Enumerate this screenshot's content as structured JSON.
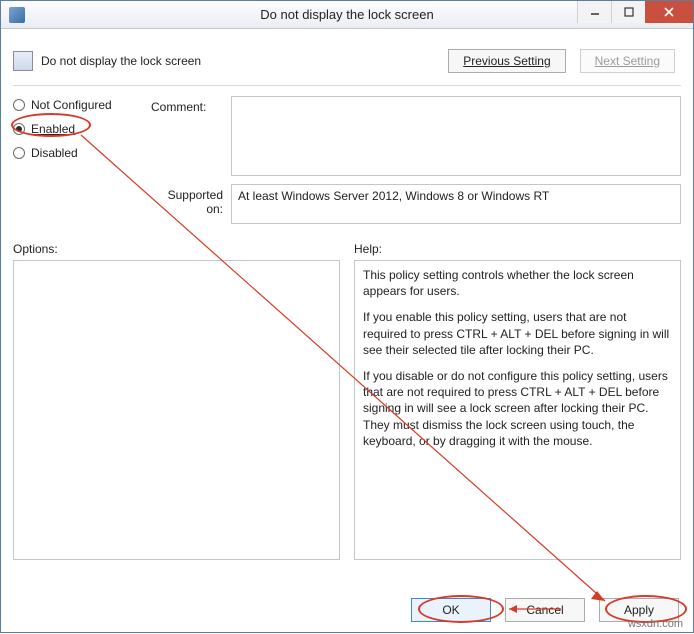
{
  "window": {
    "title": "Do not display the lock screen"
  },
  "header": {
    "policy_name": "Do not display the lock screen"
  },
  "nav": {
    "previous": "Previous Setting",
    "next": "Next Setting"
  },
  "state": {
    "not_configured": "Not Configured",
    "enabled": "Enabled",
    "disabled": "Disabled",
    "selected": "enabled"
  },
  "labels": {
    "comment": "Comment:",
    "supported_on": "Supported on:",
    "options": "Options:",
    "help": "Help:"
  },
  "fields": {
    "comment": "",
    "supported_on": "At least Windows Server 2012, Windows 8 or Windows RT"
  },
  "help": {
    "p1": "This policy setting controls whether the lock screen appears for users.",
    "p2": "If you enable this policy setting, users that are not required to press CTRL + ALT + DEL before signing in will see their selected tile after  locking their PC.",
    "p3": "If you disable or do not configure this policy setting, users that are not required to press CTRL + ALT + DEL before signing in will see a lock screen after locking their PC. They must dismiss the lock screen using touch, the keyboard, or by dragging it with the mouse."
  },
  "footer": {
    "ok": "OK",
    "cancel": "Cancel",
    "apply": "Apply"
  },
  "watermark": "wsxdn.com"
}
